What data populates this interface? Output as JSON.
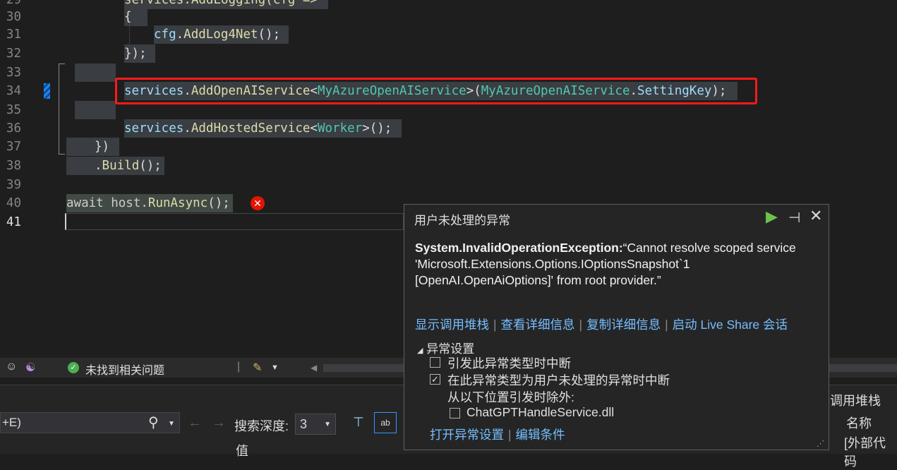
{
  "editor": {
    "lines": [
      {
        "num": "29",
        "tokens": [
          {
            "c": "m",
            "s": "services.AddLogging(cfg =>"
          }
        ]
      },
      {
        "num": "30",
        "tokens": [
          {
            "c": "p",
            "s": "{"
          }
        ]
      },
      {
        "num": "31",
        "tokens": [
          {
            "c": "v",
            "s": "cfg"
          },
          {
            "c": "p",
            "s": "."
          },
          {
            "c": "m",
            "s": "AddLog4Net"
          },
          {
            "c": "p",
            "s": "();"
          }
        ]
      },
      {
        "num": "32",
        "tokens": [
          {
            "c": "p",
            "s": "});"
          }
        ]
      },
      {
        "num": "33",
        "tokens": []
      },
      {
        "num": "34",
        "tokens": [
          {
            "c": "v",
            "s": "services"
          },
          {
            "c": "p",
            "s": "."
          },
          {
            "c": "m",
            "s": "AddOpenAIService"
          },
          {
            "c": "p",
            "s": "<"
          },
          {
            "c": "t",
            "s": "MyAzureOpenAIService"
          },
          {
            "c": "p",
            "s": ">("
          },
          {
            "c": "t",
            "s": "MyAzureOpenAIService"
          },
          {
            "c": "p",
            "s": "."
          },
          {
            "c": "v",
            "s": "SettingKey"
          },
          {
            "c": "p",
            "s": ");"
          }
        ]
      },
      {
        "num": "35",
        "tokens": []
      },
      {
        "num": "36",
        "tokens": [
          {
            "c": "v",
            "s": "services"
          },
          {
            "c": "p",
            "s": "."
          },
          {
            "c": "m",
            "s": "AddHostedService"
          },
          {
            "c": "p",
            "s": "<"
          },
          {
            "c": "t",
            "s": "Worker"
          },
          {
            "c": "p",
            "s": ">();"
          }
        ]
      },
      {
        "num": "37",
        "tokens": [
          {
            "c": "p",
            "s": "})"
          }
        ]
      },
      {
        "num": "38",
        "tokens": [
          {
            "c": "p",
            "s": "."
          },
          {
            "c": "m",
            "s": "Build"
          },
          {
            "c": "p",
            "s": "();"
          }
        ]
      },
      {
        "num": "39",
        "tokens": []
      },
      {
        "num": "40",
        "tokens": [
          {
            "c": "d",
            "s": "await host."
          },
          {
            "c": "m",
            "s": "RunAsync"
          },
          {
            "c": "p",
            "s": "();"
          }
        ]
      },
      {
        "num": "41",
        "tokens": []
      }
    ]
  },
  "statusbar": {
    "issues_text": "未找到相关问题"
  },
  "bottom_panel": {
    "search_value": "+E)",
    "depth_label": "搜索深度:",
    "depth_value": "3",
    "value_column": "值",
    "call_stack_title": "调用堆栈",
    "name_column": "名称",
    "external_code": "[外部代码"
  },
  "exception_popup": {
    "title": "用户未处理的异常",
    "exception_type": "System.InvalidOperationException:",
    "exception_message": "“Cannot resolve scoped service 'Microsoft.Extensions.Options.IOptionsSnapshot`1 [OpenAI.OpenAiOptions]' from root provider.”",
    "links": [
      "显示调用堆栈",
      "查看详细信息",
      "复制详细信息",
      "启动 Live Share 会话"
    ],
    "section_title": "异常设置",
    "opt_break_when_thrown": "引发此异常类型时中断",
    "opt_break_user_unhandled": "在此异常类型为用户未处理的异常时中断",
    "except_from_label": "从以下位置引发时除外:",
    "except_module": "ChatGPTHandleService.dll",
    "bottom_links": [
      "打开异常设置",
      "编辑条件"
    ]
  },
  "colors": {
    "method": "#dcdcaa",
    "type": "#4ec9b0",
    "variable": "#9cdcfe",
    "punct": "#dcdcdc",
    "link": "#75beff",
    "error": "#e51400",
    "highlight_box": "#ff1a1a",
    "ok": "#4caf50"
  }
}
